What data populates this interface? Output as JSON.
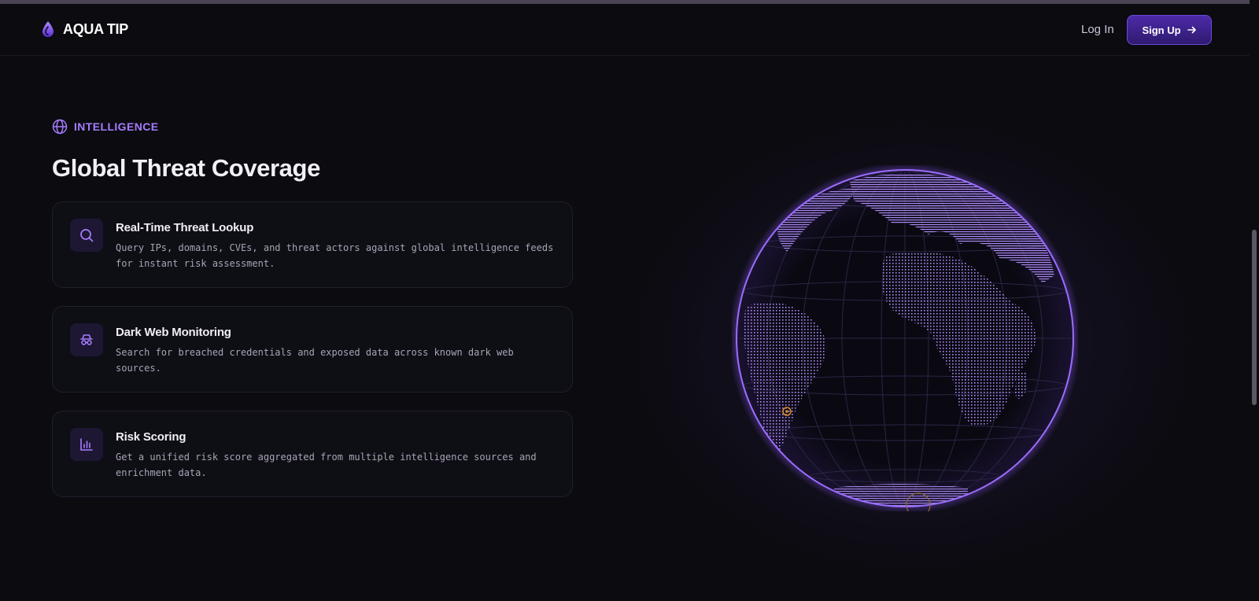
{
  "nav": {
    "brand": "AQUA TIP",
    "login": "Log In",
    "signup": "Sign Up"
  },
  "section": {
    "eyebrow": "INTELLIGENCE",
    "title": "Global Threat Coverage"
  },
  "features": [
    {
      "title": "Real-Time Threat Lookup",
      "description": "Query IPs, domains, CVEs, and threat actors against global intelligence feeds for instant risk assessment.",
      "icon": "search-icon"
    },
    {
      "title": "Dark Web Monitoring",
      "description": "Search for breached credentials and exposed data across known dark web sources.",
      "icon": "incognito-icon"
    },
    {
      "title": "Risk Scoring",
      "description": "Get a unified risk score aggregated from multiple intelligence sources and enrichment data.",
      "icon": "bar-chart-icon"
    }
  ],
  "colors": {
    "accent": "#a67cff",
    "background": "#0b0b10",
    "marker": "#e08a2a"
  }
}
